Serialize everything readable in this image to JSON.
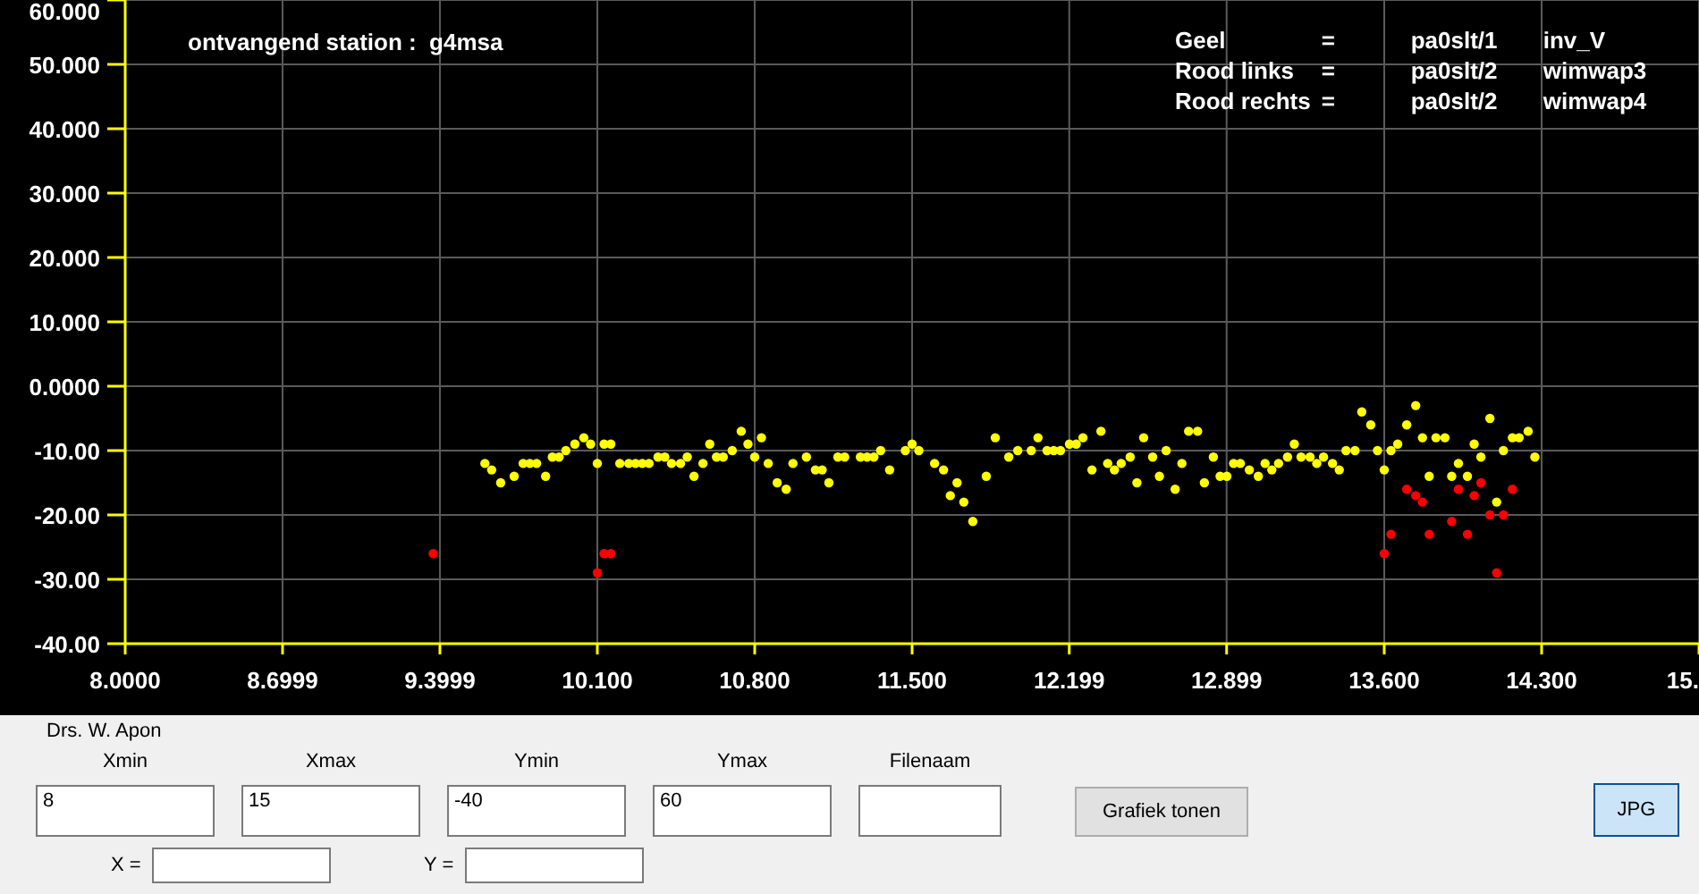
{
  "chart": {
    "title": "ontvangend station :  g4msa",
    "legend": [
      {
        "name": "Geel",
        "eq": "=",
        "station": "pa0slt/1",
        "antenna": "inv_V"
      },
      {
        "name": "Rood links",
        "eq": "=",
        "station": "pa0slt/2",
        "antenna": "wimwap3"
      },
      {
        "name": "Rood rechts",
        "eq": "=",
        "station": "pa0slt/2",
        "antenna": "wimwap4"
      }
    ],
    "chart_data": {
      "type": "scatter",
      "grid": true,
      "xlim": [
        8,
        15
      ],
      "ylim": [
        -40,
        60
      ],
      "xticks": [
        {
          "value": 8,
          "label": "8.0000"
        },
        {
          "value": 8.6999,
          "label": "8.6999"
        },
        {
          "value": 9.3999,
          "label": "9.3999"
        },
        {
          "value": 10.1,
          "label": "10.100"
        },
        {
          "value": 10.8,
          "label": "10.800"
        },
        {
          "value": 11.5,
          "label": "11.500"
        },
        {
          "value": 12.199,
          "label": "12.199"
        },
        {
          "value": 12.899,
          "label": "12.899"
        },
        {
          "value": 13.6,
          "label": "13.600"
        },
        {
          "value": 14.3,
          "label": "14.300"
        },
        {
          "value": 15,
          "label": "15."
        }
      ],
      "yticks": [
        {
          "value": 60,
          "label": "60.000"
        },
        {
          "value": 50,
          "label": "50.000"
        },
        {
          "value": 40,
          "label": "40.000"
        },
        {
          "value": 30,
          "label": "30.000"
        },
        {
          "value": 20,
          "label": "20.000"
        },
        {
          "value": 10,
          "label": "10.000"
        },
        {
          "value": 0,
          "label": "0.0000"
        },
        {
          "value": -10,
          "label": "-10.00"
        },
        {
          "value": -20,
          "label": "-20.00"
        },
        {
          "value": -30,
          "label": "-30.00"
        },
        {
          "value": -40,
          "label": "-40.00"
        }
      ],
      "x": [
        9.37,
        9.6,
        9.63,
        9.67,
        9.73,
        9.77,
        9.8,
        9.83,
        9.87,
        9.9,
        9.93,
        9.96,
        10.0,
        10.04,
        10.07,
        10.1,
        10.13,
        10.16,
        10.2,
        10.24,
        10.27,
        10.3,
        10.33,
        10.37,
        10.4,
        10.43,
        10.47,
        10.5,
        10.53,
        10.57,
        10.6,
        10.63,
        10.66,
        10.7,
        10.74,
        10.77,
        10.8,
        10.83,
        10.86,
        10.9,
        10.94,
        10.97,
        11.03,
        11.07,
        11.1,
        11.13,
        11.17,
        11.2,
        11.27,
        11.3,
        11.33,
        11.36,
        11.4,
        11.47,
        11.5,
        11.53,
        11.6,
        11.64,
        11.67,
        11.7,
        11.73,
        11.77,
        11.83,
        11.87,
        11.93,
        11.97,
        12.03,
        12.06,
        12.1,
        12.13,
        12.16,
        12.2,
        12.23,
        12.26,
        12.3,
        12.34,
        12.37,
        12.4,
        12.43,
        12.47,
        12.5,
        12.53,
        12.57,
        12.6,
        12.63,
        12.67,
        12.7,
        12.73,
        12.77,
        12.8,
        12.84,
        12.87,
        12.9,
        12.93,
        12.96,
        13.0,
        13.04,
        13.07,
        13.1,
        13.13,
        13.17,
        13.2,
        13.23,
        13.27,
        13.3,
        13.33,
        13.37,
        13.4,
        13.43,
        13.47,
        13.5,
        13.54,
        13.57,
        13.6,
        13.63,
        13.66,
        13.7,
        13.74,
        13.77,
        13.8,
        13.83,
        13.87,
        13.9,
        13.93,
        13.97,
        14.0,
        14.03,
        14.07,
        14.1,
        14.13,
        14.17,
        14.2,
        14.24,
        14.27
      ],
      "series": [
        {
          "color": "#ffff00",
          "values": [
            null,
            -12,
            -13,
            -15,
            -14,
            -12,
            -12,
            -12,
            -14,
            -11,
            -11,
            -10,
            -9,
            -8,
            -9,
            -12,
            -9,
            -9,
            -12,
            -12,
            -12,
            -12,
            -12,
            -11,
            -11,
            -12,
            -12,
            -11,
            -14,
            -12,
            -9,
            -11,
            -11,
            -10,
            -7,
            -9,
            -11,
            -8,
            -12,
            -15,
            -16,
            -12,
            -11,
            -13,
            -13,
            -15,
            -11,
            -11,
            -11,
            -11,
            -11,
            -10,
            -13,
            -10,
            -9,
            -10,
            -12,
            -13,
            -17,
            -15,
            -18,
            -21,
            -14,
            -8,
            -11,
            -10,
            -10,
            -8,
            -10,
            -10,
            -10,
            -9,
            -9,
            -8,
            -13,
            -7,
            -12,
            -13,
            -12,
            -11,
            -15,
            -8,
            -11,
            -14,
            -10,
            -16,
            -12,
            -7,
            -7,
            -15,
            -11,
            -14,
            -14,
            -12,
            -12,
            -13,
            -14,
            -12,
            -13,
            -12,
            -11,
            -9,
            -11,
            -11,
            -12,
            -11,
            -12,
            -13,
            -10,
            -10,
            -4,
            -6,
            -10,
            -13,
            -10,
            -9,
            -6,
            -3,
            -8,
            -14,
            -8,
            -8,
            -14,
            -12,
            -14,
            -9,
            -11,
            -5,
            -18,
            -10,
            -8,
            -8,
            -7,
            -11
          ]
        },
        {
          "color": "#ff0000",
          "values": [
            -26,
            null,
            null,
            null,
            null,
            null,
            null,
            null,
            null,
            null,
            null,
            null,
            null,
            null,
            null,
            -29,
            -26,
            -26,
            null,
            null,
            null,
            null,
            null,
            null,
            null,
            null,
            null,
            null,
            null,
            null,
            null,
            null,
            null,
            null,
            null,
            null,
            null,
            null,
            null,
            null,
            null,
            null,
            null,
            null,
            null,
            null,
            null,
            null,
            null,
            null,
            null,
            null,
            null,
            null,
            null,
            null,
            null,
            null,
            null,
            null,
            null,
            null,
            null,
            null,
            null,
            null,
            null,
            null,
            null,
            null,
            null,
            null,
            null,
            null,
            null,
            null,
            null,
            null,
            null,
            null,
            null,
            null,
            null,
            null,
            null,
            null,
            null,
            null,
            null,
            null,
            null,
            null,
            null,
            null,
            null,
            null,
            null,
            null,
            null,
            null,
            null,
            null,
            null,
            null,
            null,
            null,
            null,
            null,
            null,
            null,
            null,
            null,
            null,
            -26,
            -23,
            null,
            -16,
            -17,
            -18,
            -23,
            null,
            null,
            -21,
            -16,
            -23,
            -17,
            -15,
            -20,
            -29,
            -20,
            -16,
            null,
            null,
            null
          ]
        }
      ]
    }
  },
  "author": "Drs. W. Apon",
  "fields": [
    {
      "label": "Xmin",
      "value": "8",
      "kind": "wide"
    },
    {
      "label": "Xmax",
      "value": "15",
      "kind": "wide"
    },
    {
      "label": "Ymin",
      "value": "-40",
      "kind": "wide"
    },
    {
      "label": "Ymax",
      "value": "60",
      "kind": "wide"
    },
    {
      "label": "Filenaam",
      "kind": "narrow"
    }
  ],
  "show_button": "Grafiek tonen",
  "jpg_button": "JPG",
  "coords": [
    {
      "label": "X ="
    },
    {
      "label": "Y ="
    }
  ]
}
